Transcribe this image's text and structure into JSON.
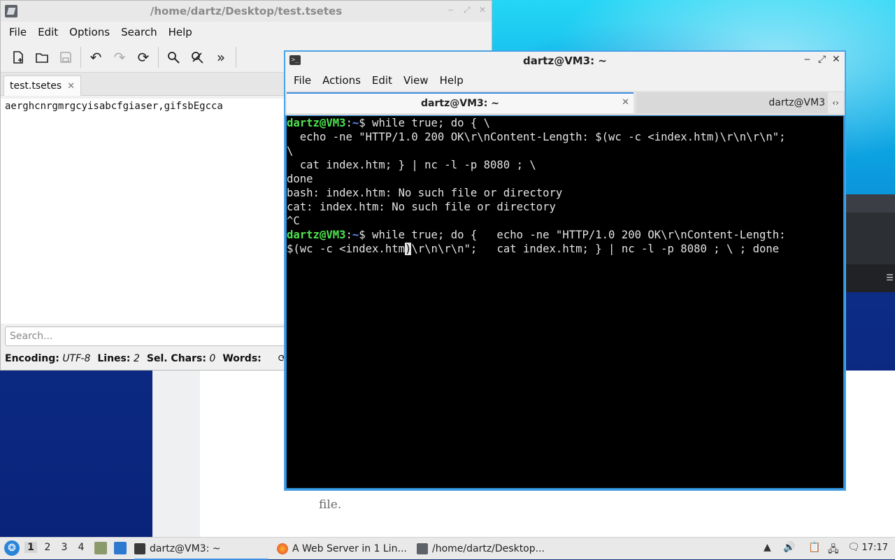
{
  "editor": {
    "title": "/home/dartz/Desktop/test.tsetes",
    "menu": [
      "File",
      "Edit",
      "Options",
      "Search",
      "Help"
    ],
    "toolbar": {
      "new": "new-document-icon",
      "open": "open-folder-icon",
      "save": "save-icon",
      "undo": "undo-icon",
      "redo": "redo-icon",
      "reload": "reload-icon",
      "find": "find-icon",
      "replace": "find-replace-icon",
      "more": "more-icon"
    },
    "tab_label": "test.tsetes",
    "content": "aerghcnrgmrgcyisabcfgiaser,gifsbEgcca",
    "search_placeholder": "Search...",
    "status": {
      "encoding_label": "Encoding:",
      "encoding_value": "UTF-8",
      "lines_label": "Lines:",
      "lines_value": "2",
      "selchars_label": "Sel. Chars:",
      "selchars_value": "0",
      "words_label": "Words:"
    }
  },
  "terminal": {
    "title": "dartz@VM3: ~",
    "menu": [
      "File",
      "Actions",
      "Edit",
      "View",
      "Help"
    ],
    "tabs": [
      "dartz@VM3: ~",
      "dartz@VM3"
    ],
    "prompt_user": "dartz@VM3",
    "prompt_sep": ":",
    "prompt_path": "~",
    "lines": {
      "l1_cmd": "$ while true; do { \\",
      "l2": "  echo -ne \"HTTP/1.0 200 OK\\r\\nContent-Length: $(wc -c <index.htm)\\r\\n\\r\\n\";",
      "l3": "\\",
      "l4": "  cat index.htm; } | nc -l -p 8080 ; \\",
      "l5": "done",
      "l6": "bash: index.htm: No such file or directory",
      "l7": "cat: index.htm: No such file or directory",
      "l8": "^C",
      "l9_cmd": "$ while true; do {   echo -ne \"HTTP/1.0 200 OK\\r\\nContent-Length:",
      "l10_pre": "$(wc -c <index.htm",
      "l10_cursor": ")",
      "l10_post": "\\r\\n\\r\\n\";   cat index.htm; } | nc -l -p 8080 ; \\ ; done"
    }
  },
  "background": {
    "caption": "file."
  },
  "taskbar": {
    "workspaces": [
      "1",
      "2",
      "3",
      "4"
    ],
    "active_workspace": "1",
    "tasks": [
      {
        "label": "dartz@VM3: ~",
        "icon": "terminal-icon"
      },
      {
        "label": "A Web Server in 1 Lin...",
        "icon": "firefox-icon"
      },
      {
        "label": "/home/dartz/Desktop...",
        "icon": "text-editor-icon"
      }
    ],
    "clock": "17:17"
  },
  "colors": {
    "prompt_user": "#4ee34e",
    "prompt_path": "#5c8cff",
    "terminal_bg": "#000000",
    "accent": "#3a8de0"
  }
}
